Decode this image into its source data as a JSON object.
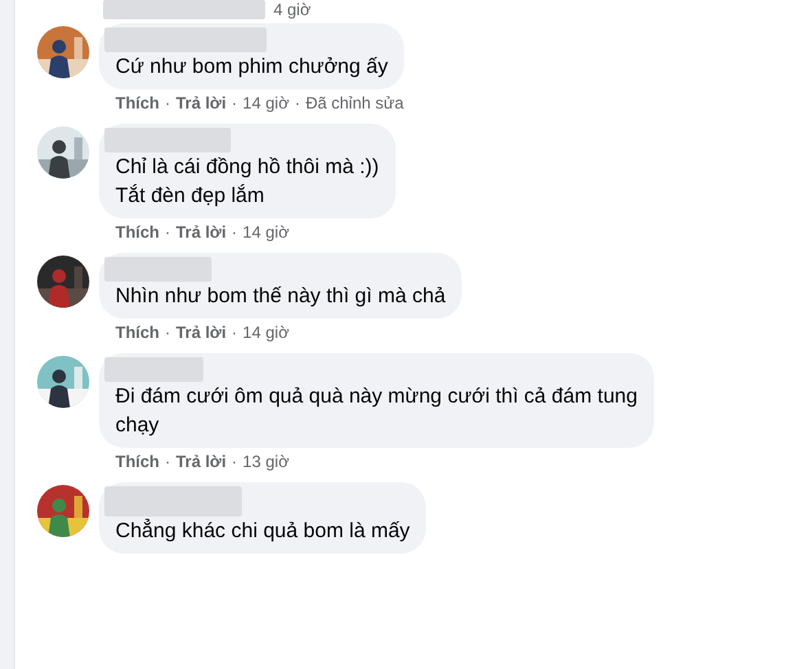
{
  "top_meta": {
    "time": "4 giờ"
  },
  "separator": "·",
  "comments": [
    {
      "lines": [
        "Cứ như bom phim chưởng ấy"
      ],
      "like": "Thích",
      "reply": "Trả lời",
      "time": "14 giờ",
      "edited": "Đã chỉnh sửa"
    },
    {
      "lines": [
        "Chỉ là cái đồng hồ thôi mà :))",
        "Tắt đèn đẹp lắm"
      ],
      "like": "Thích",
      "reply": "Trả lời",
      "time": "14 giờ"
    },
    {
      "lines": [
        "Nhìn như bom thế này thì gì mà chả"
      ],
      "like": "Thích",
      "reply": "Trả lời",
      "time": "14 giờ"
    },
    {
      "lines": [
        "Đi đám cưới ôm quả quà này mừng cưới thì cả đám tung",
        "chạy"
      ],
      "like": "Thích",
      "reply": "Trả lời",
      "time": "13 giờ"
    },
    {
      "lines": [
        "Chẳng khác chi quả bom là mấy"
      ]
    }
  ]
}
